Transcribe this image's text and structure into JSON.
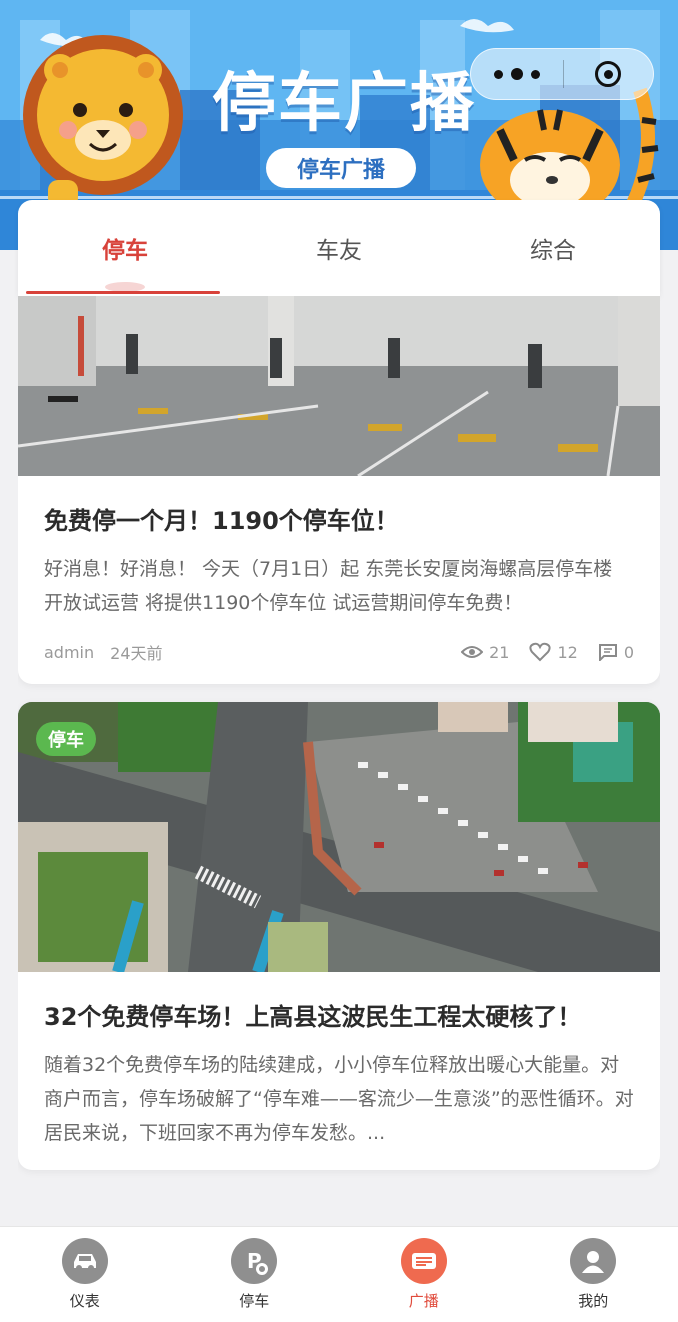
{
  "banner": {
    "title": "停车广播",
    "pill": "停车广播"
  },
  "tabs": [
    {
      "label": "停车",
      "active": true
    },
    {
      "label": "车友",
      "active": false
    },
    {
      "label": "综合",
      "active": false
    }
  ],
  "posts": [
    {
      "title": "免费停一个月！1190个停车位！",
      "description": "好消息！好消息！ 今天（7月1日）起 东莞长安厦岗海螺高层停车楼 开放试运营 将提供1190个停车位 试运营期间停车免费！",
      "author": "admin",
      "time": "24天前",
      "views": "21",
      "likes": "12",
      "comments": "0"
    },
    {
      "tag": "停车",
      "title": "32个免费停车场！上高县这波民生工程太硬核了！",
      "description": "随着32个免费停车场的陆续建成，小小停车位释放出暖心大能量。对商户而言，停车场破解了“停车难——客流少—生意淡”的恶性循环。对居民来说，下班回家不再为停车发愁。..."
    }
  ],
  "tabbar": [
    {
      "label": "仪表",
      "icon": "car-icon",
      "active": false
    },
    {
      "label": "停车",
      "icon": "parking-icon",
      "active": false
    },
    {
      "label": "广播",
      "icon": "broadcast-icon",
      "active": true
    },
    {
      "label": "我的",
      "icon": "user-icon",
      "active": false
    }
  ],
  "colors": {
    "accent": "#d8423a",
    "tag_green": "#5bb84f",
    "banner_blue": "#3e9ce8"
  }
}
